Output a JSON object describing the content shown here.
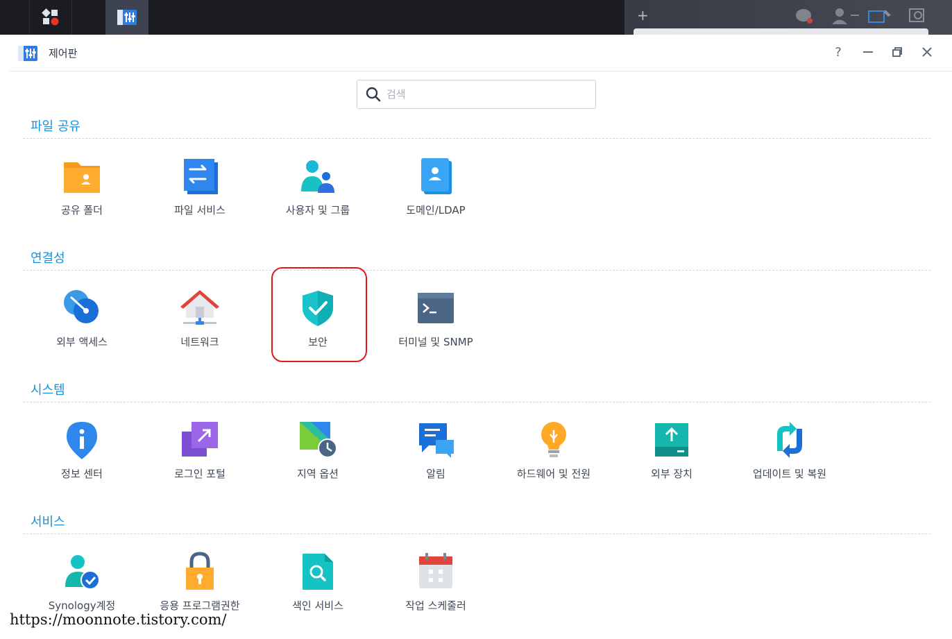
{
  "window": {
    "title": "제어판"
  },
  "controls": {
    "help": "?",
    "minimize": "—",
    "restore": "❐",
    "close": "✕"
  },
  "search": {
    "placeholder": "검색"
  },
  "sections": [
    {
      "title": "파일 공유",
      "items": [
        "공유 폴더",
        "파일 서비스",
        "사용자 및 그룹",
        "도메인/LDAP"
      ]
    },
    {
      "title": "연결성",
      "items": [
        "외부 액세스",
        "네트워크",
        "보안",
        "터미널 및 SNMP"
      ]
    },
    {
      "title": "시스템",
      "items": [
        "정보 센터",
        "로그인 포털",
        "지역 옵션",
        "알림",
        "하드웨어 및 전원",
        "외부 장치",
        "업데이트 및 복원"
      ]
    },
    {
      "title": "서비스",
      "items": [
        "Synology계정",
        "응용 프로그램권한",
        "색인 서비스",
        "작업 스케줄러"
      ]
    }
  ],
  "taskbar": {
    "add_label": "+"
  },
  "watermark": "https://moonnote.tistory.com/",
  "colors": {
    "accent": "#1a8fd8",
    "highlight": "#e0181a"
  }
}
